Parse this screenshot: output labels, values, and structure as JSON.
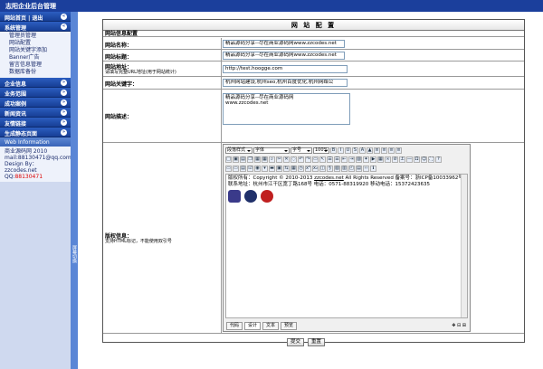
{
  "topbar": {
    "title": "志阳企业后台管理"
  },
  "sidebar": {
    "header1": {
      "left": "网站首页",
      "sep": "|",
      "right": "退出"
    },
    "system": {
      "label": "系统管理",
      "items": [
        "管理员管理",
        "网站配置",
        "网站关键字添加",
        "Banner广告",
        "留言信息管理",
        "数据库备份"
      ]
    },
    "groups": [
      "企业信息",
      "业务范围",
      "成功案例",
      "新闻资讯",
      "友情链接",
      "生成静态页面"
    ],
    "info": {
      "label": "Web Information",
      "lines": [
        "商业源码网 2010",
        "mail:88130471@qq.com",
        "Design By：  zzcodes.net"
      ],
      "qq_label": "QQ:",
      "qq_value": "88130471"
    }
  },
  "splitter": {
    "label": "屏幕切换"
  },
  "main": {
    "title": "网 站 配 置",
    "section": "网站信息配置",
    "site_name": {
      "label": "网站名称：",
      "value": "精品源码分享--尽在商业源码网www.zzcodes.net"
    },
    "site_title": {
      "label": "网站标题：",
      "value": "精品源码分享--尽在商业源码网www.zzcodes.net"
    },
    "site_url": {
      "label": "网站地址：",
      "hint": "请填写完整URL地址(用于网站统计)",
      "value": "http://test.hoogge.com"
    },
    "keywords": {
      "label": "网站关键字：",
      "value": "杭州网站建设,杭州seo,杭州百度优化,杭州网络公"
    },
    "description": {
      "label": "网站描述：",
      "line1": "精品源码分享--尽在商业源码网",
      "line2": "www.zzcodes.net"
    },
    "copyright": {
      "label": "版权信息：",
      "hint": "支持HTML标记，不能使用双引号",
      "toolbar": {
        "style": "段落样式",
        "font": "字体",
        "size": "字号",
        "zoom": "100%"
      },
      "content_line1_prefix": "版权所有：Copyright © 2010-2013 ",
      "content_link": "zzcodes.net",
      "content_line1_suffix": " All Rights Reserved  备案号：浙ICP备10033962号",
      "content_line2": "联系地址：杭州市江干区宽丁路168号  电话：0571-88319920  移动电话：15372423635",
      "tabs": [
        "代码",
        "设计",
        "文本",
        "预览"
      ]
    },
    "submit_label": "提交",
    "reset_label": "重置"
  },
  "colors": {
    "accent": "#1b3f9c",
    "sidebar_bg": "#cfd9ef",
    "splitter": "#5a86d6"
  }
}
